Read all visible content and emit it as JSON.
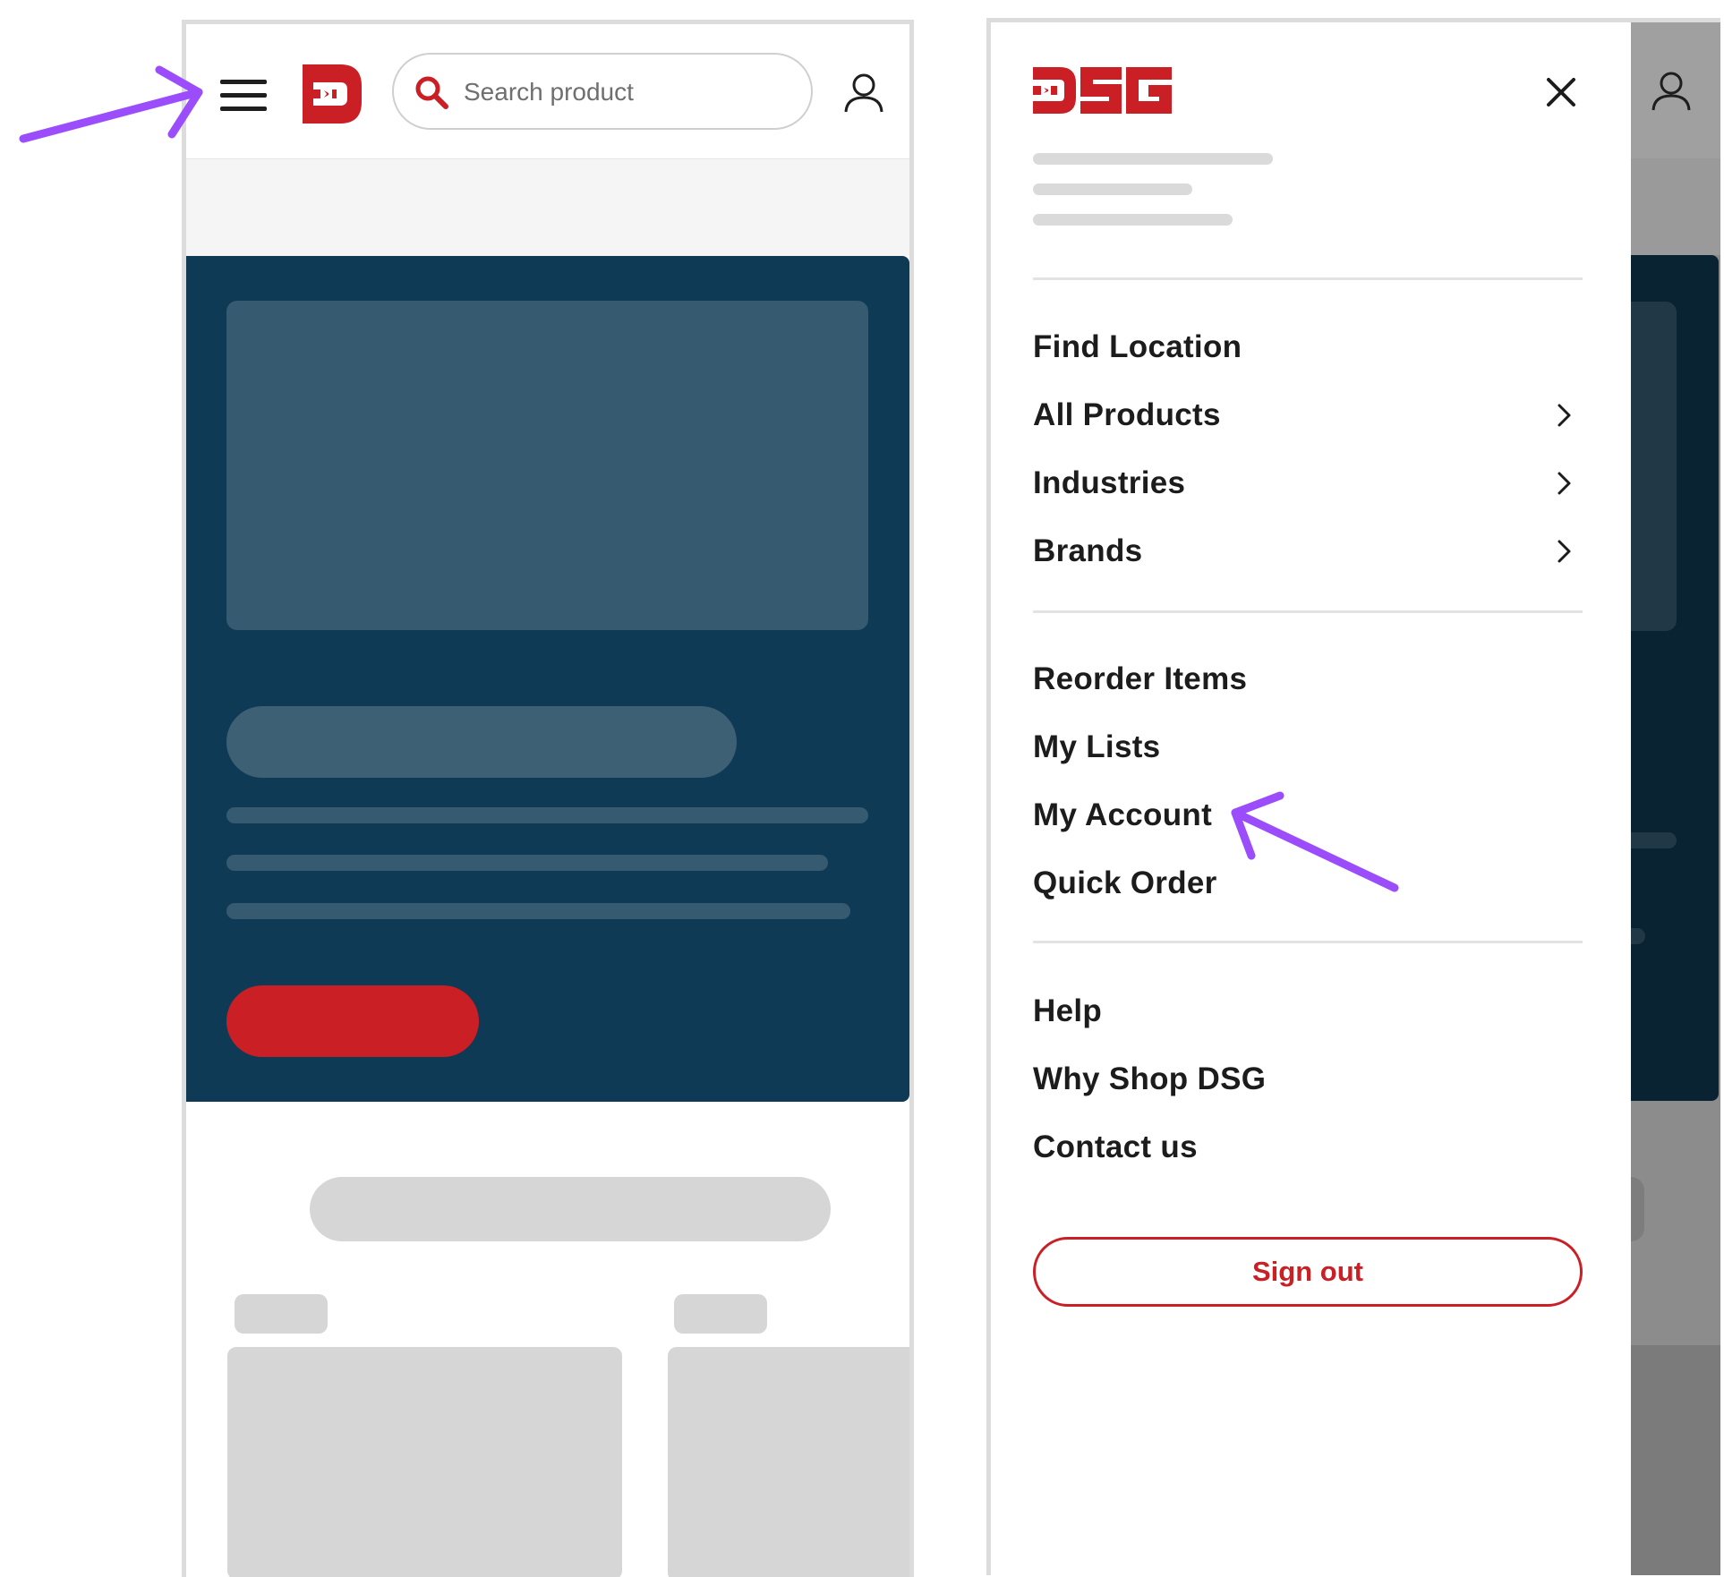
{
  "colors": {
    "brand_red": "#c91f25",
    "hero_navy": "#0f3a56",
    "annotation_purple": "#9b4dfb",
    "skeleton_gray": "#d6d6d6"
  },
  "left_screen": {
    "header": {
      "menu_icon": "hamburger-icon",
      "logo_icon": "dsg-d-logo-icon",
      "search": {
        "placeholder": "Search product",
        "value": "",
        "icon": "search-icon"
      },
      "account_icon": "user-icon"
    }
  },
  "right_screen": {
    "drawer": {
      "logo_icon": "dsg-wordmark-logo-icon",
      "close_icon": "close-icon",
      "primary_nav": [
        {
          "label": "Find Location",
          "has_submenu": false
        },
        {
          "label": "All Products",
          "has_submenu": true
        },
        {
          "label": "Industries",
          "has_submenu": true
        },
        {
          "label": "Brands",
          "has_submenu": true
        }
      ],
      "account_nav": [
        {
          "label": "Reorder Items"
        },
        {
          "label": "My Lists"
        },
        {
          "label": "My Account"
        },
        {
          "label": "Quick Order"
        }
      ],
      "support_nav": [
        {
          "label": "Help"
        },
        {
          "label": "Why Shop DSG"
        },
        {
          "label": "Contact us"
        }
      ],
      "signout_label": "Sign out"
    },
    "background_account_icon": "user-icon"
  },
  "annotations": [
    {
      "name": "arrow-to-hamburger",
      "icon": "arrow-icon"
    },
    {
      "name": "arrow-to-my-account",
      "icon": "arrow-icon"
    }
  ]
}
